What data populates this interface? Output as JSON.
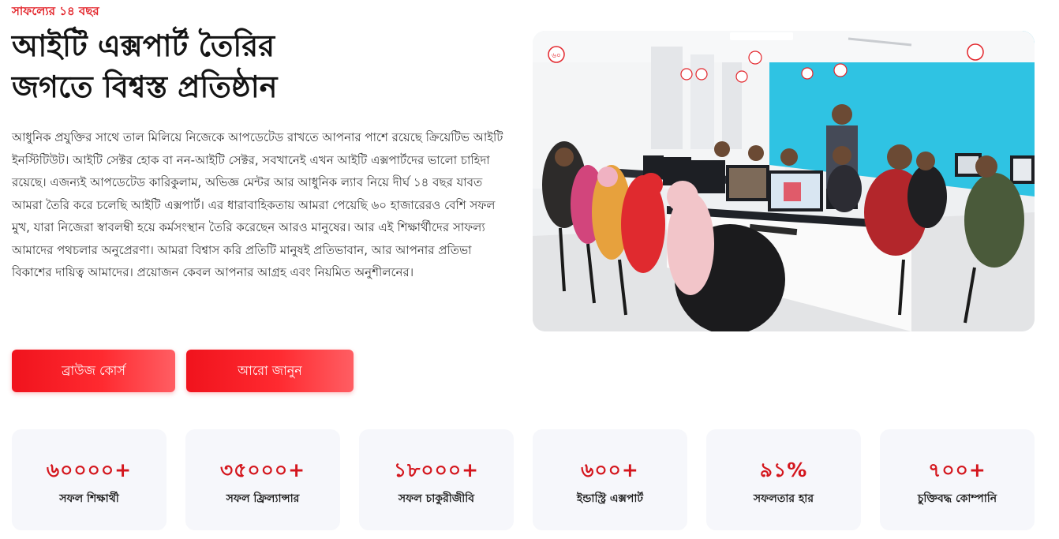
{
  "hero": {
    "eyebrow": "সাফল্যের ১৪ বছর",
    "title_line1": "আইটি এক্সপার্ট তৈরির",
    "title_line2": "জগতে বিশ্বস্ত প্রতিষ্ঠান",
    "description": "আধুনিক প্রযুক্তির সাথে তাল মিলিয়ে নিজেকে আপডেটেড রাখতে আপনার পাশে রয়েছে ক্রিয়েটিভ আইটি ইনস্টিটিউট। আইটি সেক্টর হোক বা নন-আইটি সেক্টর, সবখানেই এখন আইটি এক্সপার্টদের ভালো চাহিদা রয়েছে। এজন্যই আপডেটেড কারিকুলাম, অভিজ্ঞ মেন্টর আর আধুনিক ল্যাব নিয়ে দীর্ঘ ১৪ বছর যাবত আমরা তৈরি করে চলেছি আইটি এক্সপার্ট। এর ধারাবাহিকতায় আমরা পেয়েছি ৬০ হাজারেরও বেশি সফল মুখ, যারা নিজেরা স্বাবলম্বী হয়ে কর্মসংস্থান তৈরি করেছেন আরও মানুষের। আর এই শিক্ষার্থীদের সাফল্য আমাদের পথচলার অনুপ্রেরণা। আমরা বিশ্বাস করি প্রতিটি মানুষই প্রতিভাবান, আর আপনার প্রতিভা বিকাশের দায়িত্ব আমাদের। প্রয়োজন কেবল আপনার আগ্রহ এবং নিয়মিত অনুশীলনের।",
    "browse_button": "ব্রাউজ কোর্স",
    "more_button": "আরো জানুন"
  },
  "photo": {
    "icon": "classroom-photo",
    "badge_text": "৬০"
  },
  "stats": [
    {
      "value": "৬০০০০+",
      "label": "সফল শিক্ষার্থী"
    },
    {
      "value": "৩৫০০০+",
      "label": "সফল ফ্রিল্যান্সার"
    },
    {
      "value": "১৮০০০+",
      "label": "সফল চাকুরীজীবি"
    },
    {
      "value": "৬০০+",
      "label": "ইন্ডাস্ট্রি এক্সপার্ট"
    },
    {
      "value": "৯১%",
      "label": "সফলতার হার"
    },
    {
      "value": "৭০০+",
      "label": "চুক্তিবদ্ধ কোম্পানি"
    }
  ],
  "colors": {
    "accent": "#e3262c",
    "stat_value": "#d4161d",
    "card_bg": "#f6f7fb",
    "wall_blue": "#2fc3e3"
  }
}
